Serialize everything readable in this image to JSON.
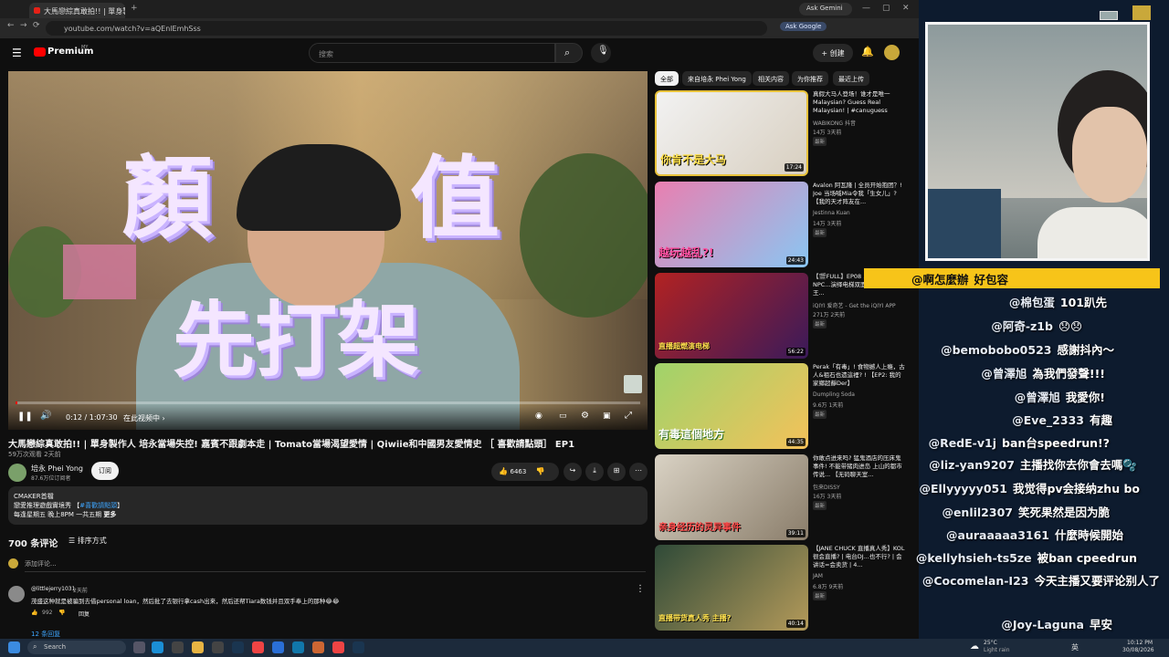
{
  "browser": {
    "tab_title": "大馬戀綜真敢拍!! | 單身製作",
    "tab_title_2": "Ask Gemini",
    "url": "youtube.com/watch?v=aQEnlEmhSss",
    "ask_google": "Ask Google",
    "new_tab": "+",
    "win_controls": [
      "—",
      "▢",
      "✕"
    ]
  },
  "youtube": {
    "logo": "Premium",
    "logo_region": "MY",
    "search_placeholder": "搜索",
    "create_label": "+ 创建",
    "video": {
      "overlay_text_1": "顏",
      "overlay_text_2": "值",
      "overlay_text_3": "先打架",
      "time": "0:12 / 1:07:30",
      "chapter": "在此视频中 ›",
      "progress": 0.003,
      "title": "大馬戀綜真敢拍!! | 單身製作人 培永當場失控!  嘉賓不跟劇本走 | Tomato當場渴望愛情 | Qiwiie和中國男友愛情史 ［ 喜歡請點頭］ EP1",
      "views": "59万次观看 2天前",
      "channel": "培永 Phei Yong",
      "subscribers": "87.6万位订阅者",
      "subscribe": "订阅",
      "likes": "6463",
      "desc_line1": "CMAKER首檔",
      "desc_line2_a": "戀愛推理遊戲實境秀 【",
      "desc_line2_link": "#喜歡請點頭",
      "desc_line2_b": "】",
      "desc_line3": "每逢星期五 晚上8PM 一共五期 ",
      "desc_more": "更多"
    },
    "comments": {
      "count_label": "700 条评论",
      "sort_label": "排序方式",
      "add_placeholder": "添加评论...",
      "first": {
        "user": "@littlejerry1031",
        "age": "2天前",
        "text": "茂盛这种就是被骗到去借personal loan，然后批了去银行拿cash出来，然后还帮Tiara数钱并且双手奉上的那种😂😂",
        "likes": "992",
        "reply": "回复"
      },
      "replies_label": "12 条回复"
    },
    "chips": [
      "全部",
      "来自培永 Phei Yong",
      "相关内容",
      "为你推荐",
      "最近上传"
    ],
    "recommendations": [
      {
        "caption": "你肯不是大马",
        "duration": "17:24",
        "title": "真假大马人登场！谁才是唯一Malaysian? Guess Real Malaysian! | #canuguess",
        "channel": "WABIKONG 抖音",
        "stats": "14万 3天前",
        "badge": "最新"
      },
      {
        "caption": "越玩越乱?!",
        "duration": "24:43",
        "title": "Avalon 阿瓦隆 | 全员开始抱团？! Joe 当场喊Mia令我「生女儿」? 【我的天才阵友在...",
        "channel": "Jestinna Kuan",
        "stats": "14万 3天前",
        "badge": "最新"
      },
      {
        "caption": "直播超燃演电梯",
        "duration": "56:22",
        "title": "【🎬FULL】EP08 ...宽暇山歌吓懵NPC...演绎电梯双面人🔥 | 喜剧之王...",
        "channel": "iQIYI 爱奇艺 - Get the iQIYI APP",
        "stats": "271万 2天前",
        "badge": "最新"
      },
      {
        "caption": "有毒這個地方",
        "duration": "44:35",
        "title": "Perak「有毒」! 食物撼人上瘾，古人&祖石也遗這裡? ! 【EP2: 我的家鄉超靜Der】",
        "channel": "Dumpling Soda",
        "stats": "9.6万 1天前",
        "badge": "最新"
      },
      {
        "caption": "亲身经历的灵异事件",
        "duration": "39:11",
        "title": "你敢点进来吗? 猛鬼酒店的压床鬼事件! 不能带猪肉进岛 上山的都市传说... 【无码聊天室...",
        "channel": "包来DISSY",
        "stats": "16万 3天前",
        "badge": "最新"
      },
      {
        "caption": "直播带货真人秀 主播?",
        "duration": "40:14",
        "title": "【JANE CHUCK 直播真人秀】KOL很会直播? | 电台DJ...也不行? | 会讲话=会卖货 | 4...",
        "channel": "JAM",
        "stats": "6.8万 9天前",
        "badge": "最新"
      }
    ]
  },
  "chat": [
    {
      "user": "@啊怎麼辦",
      "msg": "好包容",
      "highlight": true
    },
    {
      "user": "@棉包蛋",
      "msg": "101趴先",
      "highlight": false
    },
    {
      "user": "@阿奇-z1b",
      "msg": "😞😞",
      "highlight": false
    },
    {
      "user": "@bemobobo0523",
      "msg": "感謝抖內～",
      "highlight": false
    },
    {
      "user": "@曾澤旭",
      "msg": "為我們發聲!!!",
      "highlight": false
    },
    {
      "user": "@曾澤旭",
      "msg": "我愛你!",
      "highlight": false
    },
    {
      "user": "@Eve_2333",
      "msg": "有趣",
      "highlight": false
    },
    {
      "user": "@RedE-v1j",
      "msg": "ban台speedrun!?",
      "highlight": false
    },
    {
      "user": "@liz-yan9207",
      "msg": "主播找你去你會去嗎🫧",
      "highlight": false
    },
    {
      "user": "@Ellyyyyy051",
      "msg": "我觉得pv会接纳zhu bo",
      "highlight": false
    },
    {
      "user": "@enlil2307",
      "msg": "笑死果然是因为脆",
      "highlight": false
    },
    {
      "user": "@auraaaaa3161",
      "msg": "什麼時候開始",
      "highlight": false
    },
    {
      "user": "@kellyhsieh-ts5ze",
      "msg": "被ban cpeedrun",
      "highlight": false
    },
    {
      "user": "@Cocomelan-I23",
      "msg": "今天主播又要评论别人了",
      "highlight": false
    },
    {
      "user": "@Joy-Laguna",
      "msg": "早安",
      "highlight": false
    }
  ],
  "taskbar": {
    "search": "Search",
    "weather_temp": "25°C",
    "weather_desc": "Light rain",
    "lang": "英",
    "time": "10:12 PM",
    "date": "30/08/2026"
  },
  "colors": {
    "accent": "#ff0000",
    "highlight": "#f7c419",
    "bg": "#0f0f0f"
  }
}
